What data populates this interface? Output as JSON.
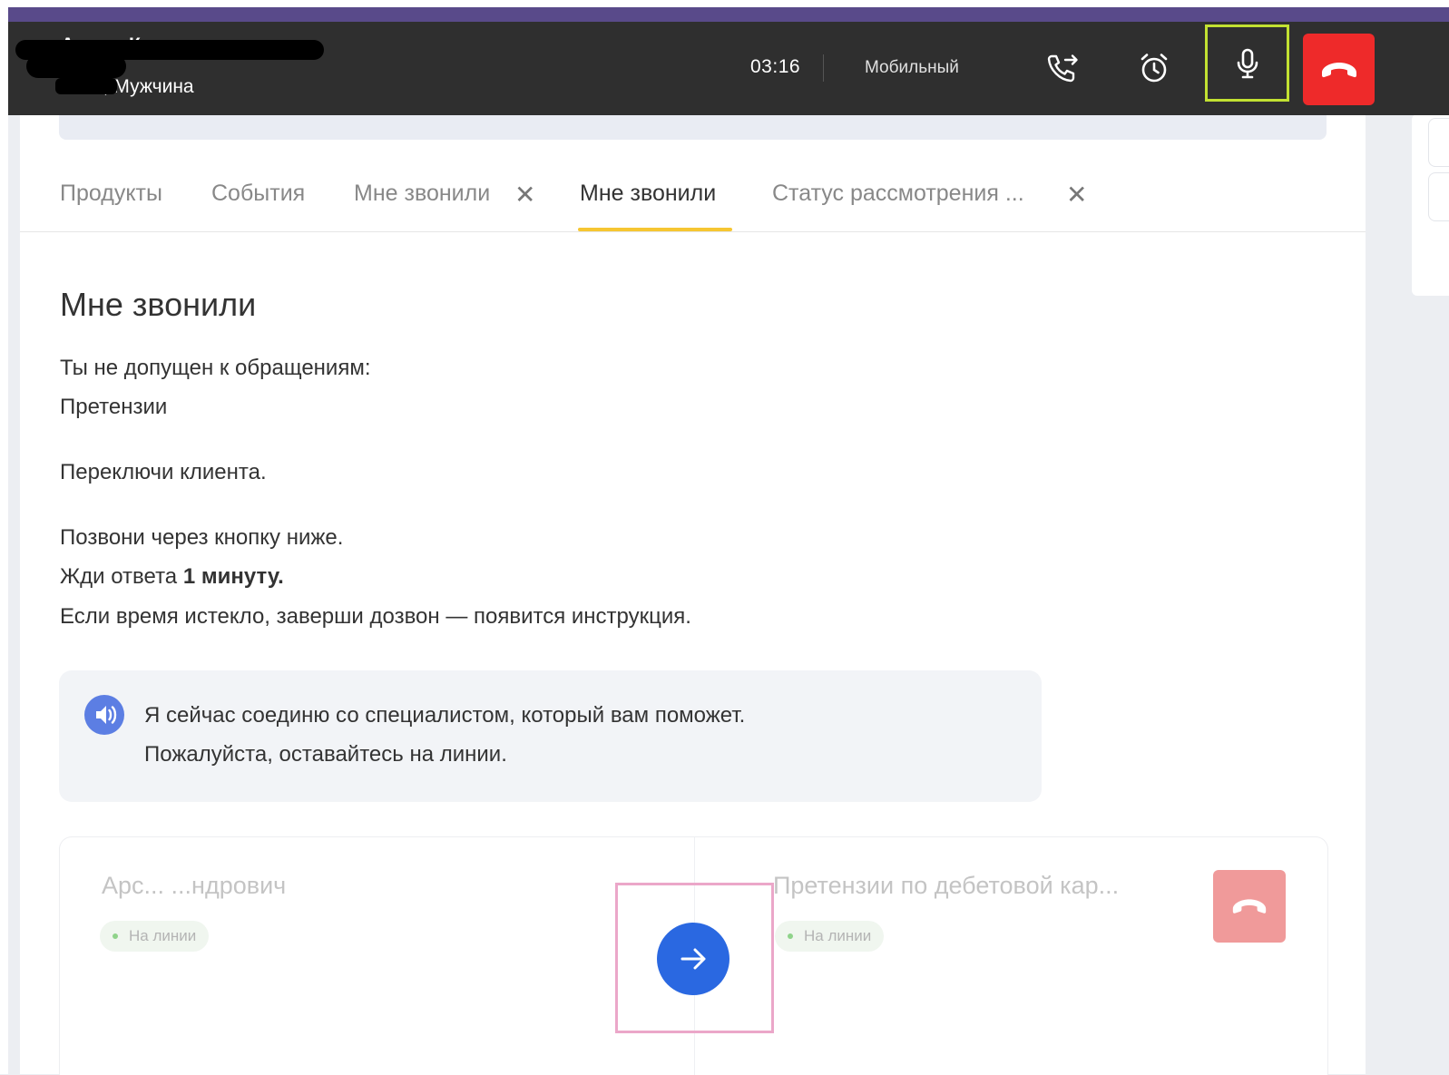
{
  "call_bar": {
    "caller_name": "Ан.. ..ч К.. .. ..",
    "caller_meta": "19 ..., Мужчина",
    "timer": "03:16",
    "phone_type": "Мобильный",
    "icons": [
      "call-transfer-icon",
      "alarm-clock-icon",
      "microphone-icon",
      "hang-up-icon"
    ],
    "colors": {
      "bar": "#2f2f2f",
      "hangup": "#ee2a2a",
      "mic_highlight": "#c2e132",
      "top_strip": "#594a8a"
    }
  },
  "tabs": [
    {
      "label": "Продукты",
      "active": false,
      "closable": false
    },
    {
      "label": "События",
      "active": false,
      "closable": false
    },
    {
      "label": "Мне звонили",
      "active": false,
      "closable": true
    },
    {
      "label": "Мне звонили",
      "active": true,
      "closable": false
    },
    {
      "label": "Статус рассмотрения ...",
      "active": false,
      "closable": true
    }
  ],
  "tab_close_glyph": "✕",
  "main": {
    "title": "Мне звонили",
    "not_allowed": "Ты не допущен к обращениям:",
    "category": "Претензии",
    "switch_client": "Переключи клиента.",
    "call_below": "Позвони через кнопку ниже.",
    "wait_prefix": "Жди ответа ",
    "wait_bold": "1 минуту.",
    "timeout": "Если время истекло, заверши дозвон — появится инструкция."
  },
  "script": {
    "line1": "Я сейчас соединю со специалистом, который вам поможет.",
    "line2": "Пожалуйста, оставайтесь на линии."
  },
  "transfer": {
    "left_party": "Арс... ...ндрович",
    "left_status": "На линии",
    "right_party": "Претензии по дебетовой кар...",
    "right_status": "На линии",
    "colors": {
      "forward_button": "#2a68e1",
      "hangup_disabled": "#f09a9a",
      "status_dot": "#8fd38a"
    }
  }
}
